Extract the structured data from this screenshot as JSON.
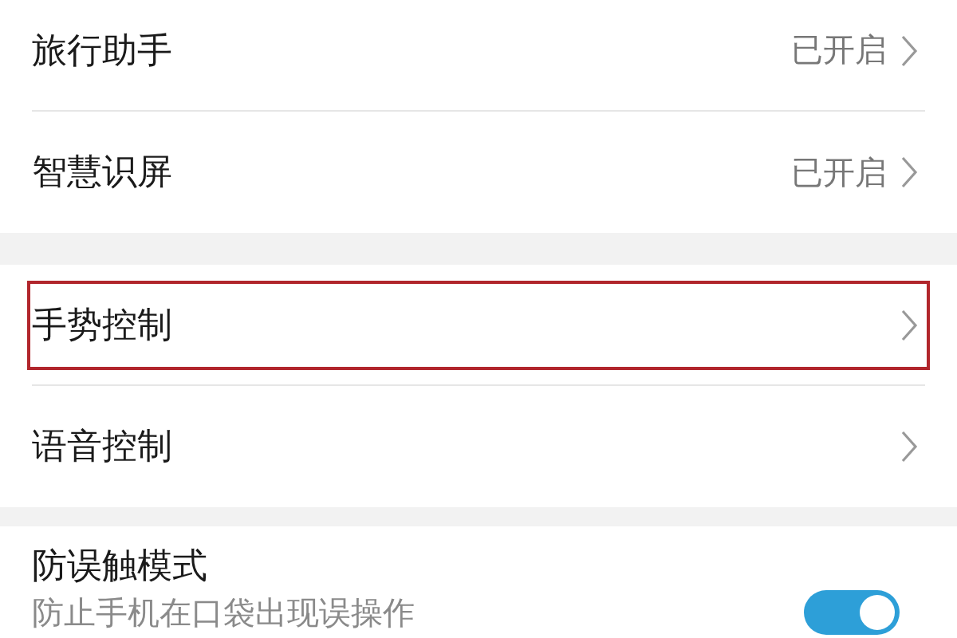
{
  "groups": [
    {
      "rows": [
        {
          "kind": "link",
          "title": "旅行助手",
          "value": "已开启",
          "highlighted": false
        },
        {
          "kind": "link",
          "title": "智慧识屏",
          "value": "已开启",
          "highlighted": false
        }
      ]
    },
    {
      "rows": [
        {
          "kind": "link",
          "title": "手势控制",
          "highlighted": true
        },
        {
          "kind": "link",
          "title": "语音控制",
          "highlighted": false
        }
      ]
    },
    {
      "rows": [
        {
          "kind": "switch",
          "title": "防误触模式",
          "subtitle": "防止手机在口袋出现误操作",
          "on": true,
          "highlighted": false
        }
      ]
    }
  ]
}
